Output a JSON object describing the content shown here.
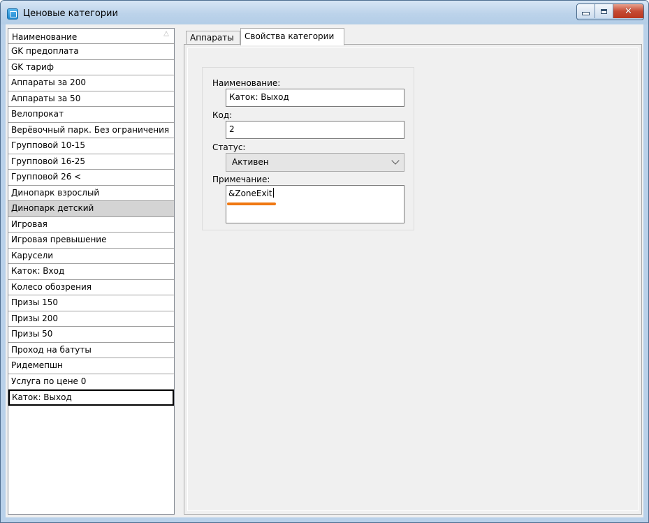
{
  "window": {
    "title": "Ценовые категории"
  },
  "list": {
    "header": "Наименование",
    "items": [
      "GK  предоплата",
      "GK тариф",
      "Аппараты за 200",
      "Аппараты за 50",
      "Велопрокат",
      "Верёвочный парк. Без ограничения",
      "Групповой 10-15",
      "Групповой 16-25",
      "Групповой 26 <",
      "Динопарк взрослый",
      "Динопарк детский",
      "Игровая",
      "Игровая превышение",
      "Карусели",
      "Каток: Вход",
      "Колесо обозрения",
      "Призы 150",
      "Призы 200",
      "Призы 50",
      "Проход на батуты",
      "Ридемепшн",
      "Услуга по цене 0",
      "Каток: Выход"
    ],
    "highlighted_item": "Динопарк детский",
    "current_item": "Каток: Выход"
  },
  "tabs": {
    "devices": "Аппараты",
    "properties": "Свойства категории",
    "active": "Свойства категории"
  },
  "form": {
    "name_label": "Наименование:",
    "name_value": "Каток: Выход",
    "code_label": "Код:",
    "code_value": "2",
    "status_label": "Статус:",
    "status_value": "Активен",
    "note_label": "Примечание:",
    "note_value": "&ZoneExit"
  },
  "colors": {
    "annotation_underline": "#f07812",
    "title_bar": "#bcd3ea",
    "highlight_row": "#d4d4d4"
  }
}
